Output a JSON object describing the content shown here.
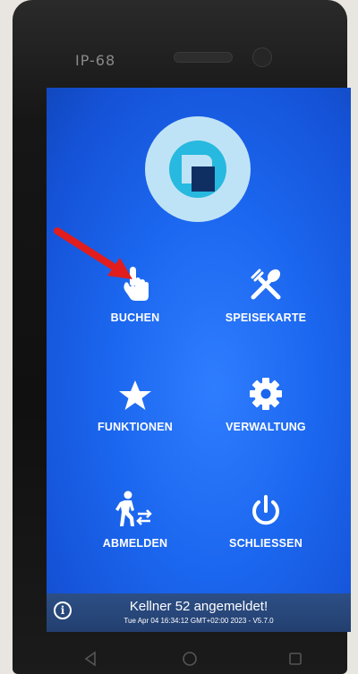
{
  "device": {
    "label": "IP-68"
  },
  "tiles": [
    {
      "label": "BUCHEN",
      "icon": "hand-pointer-icon"
    },
    {
      "label": "SPEISEKARTE",
      "icon": "fork-spoon-icon"
    },
    {
      "label": "FUNKTIONEN",
      "icon": "star-icon"
    },
    {
      "label": "VERWALTUNG",
      "icon": "gear-icon"
    },
    {
      "label": "ABMELDEN",
      "icon": "logout-person-icon"
    },
    {
      "label": "SCHLIESSEN",
      "icon": "power-icon"
    }
  ],
  "status": {
    "message": "Kellner 52 angemeldet!",
    "datetime": "Tue Apr 04 16:34:12 GMT+02:00 2023 - V5.7.0"
  },
  "colors": {
    "screen": "#1b66ee",
    "arrow": "#e11d1d",
    "status_bar": "#2d4f85"
  }
}
